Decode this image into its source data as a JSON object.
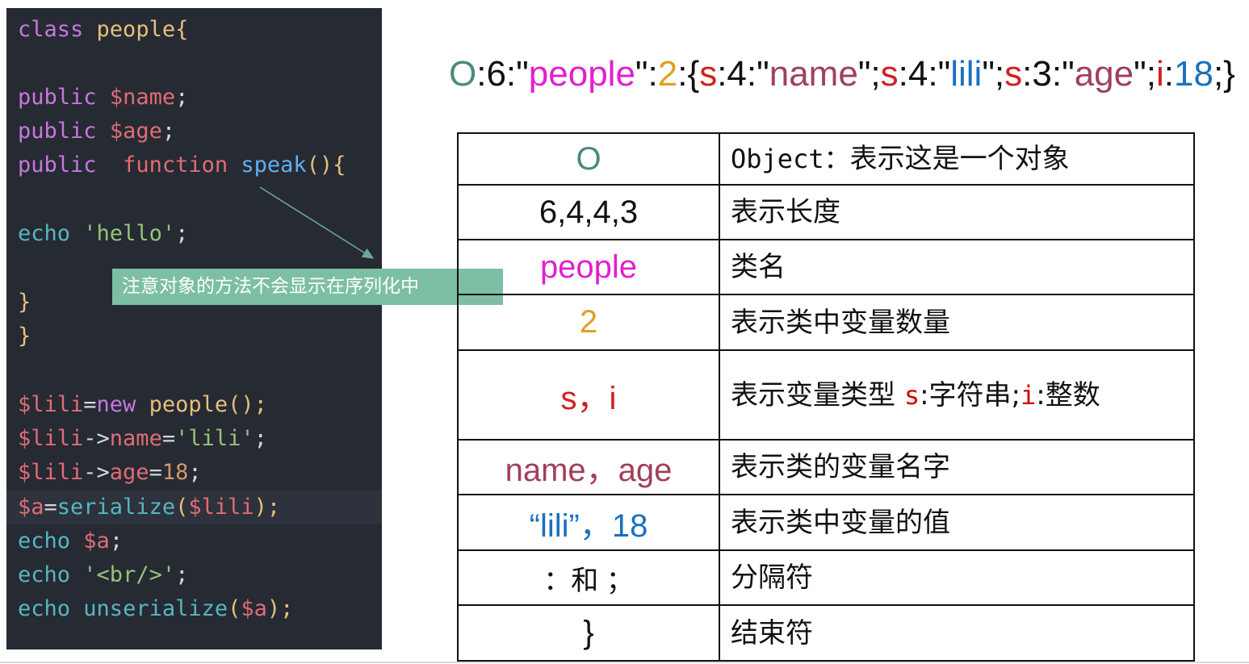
{
  "code": {
    "lines": {
      "l1": {
        "kw": "class",
        "name": "people",
        "brace": "{"
      },
      "l2": {
        "kw": "public",
        "var": "$name",
        "end": ";"
      },
      "l3": {
        "kw": "public",
        "var": "$age",
        "end": ";"
      },
      "l4": {
        "kw": "public",
        "kw2": "function",
        "fn": "speak",
        "end": "(){"
      },
      "l5": {
        "kw": "echo",
        "str": "'hello'",
        "end": ";"
      },
      "l6": {
        "brace": "}"
      },
      "l7": {
        "brace": "}"
      },
      "l8": {
        "var": "$lili",
        "op": "=",
        "kw": "new",
        "cls": "people",
        "end": "();"
      },
      "l9": {
        "var": "$lili",
        "op": "->",
        "prop": "name",
        "eq": "=",
        "str": "'lili'",
        "end": ";"
      },
      "l10": {
        "var": "$lili",
        "op": "->",
        "prop": "age",
        "eq": "=",
        "num": "18",
        "end": ";"
      },
      "l11": {
        "var": "$a",
        "eq": "=",
        "fn": "serialize",
        "open": "(",
        "arg": "$lili",
        "end": ");"
      },
      "l12": {
        "kw": "echo",
        "var": "$a",
        "end": ";"
      },
      "l13": {
        "kw": "echo",
        "str": "'<br/>'",
        "end": ";"
      },
      "l14": {
        "kw": "echo",
        "fn": "unserialize",
        "open": "(",
        "arg": "$a",
        "end": ");"
      }
    }
  },
  "annotation": {
    "text": "注意对象的方法不会显示在序列化中"
  },
  "serialized": {
    "parts": {
      "O": "O",
      "c1": ":6:",
      "q1": "\"",
      "people": "people",
      "q2": "\"",
      "c2": ":",
      "n2": "2",
      "c3": ":{",
      "s1": "s",
      "c4": ":4:\"",
      "name": "name",
      "c5": "\";",
      "s2": "s",
      "c6": ":4:\"",
      "lili": "lili",
      "c7": "\";",
      "s3": "s",
      "c8": ":3:\"",
      "age": "age",
      "c9": "\";",
      "i": "i",
      "c10": ":",
      "n18": "18",
      "end": ";}"
    }
  },
  "table": {
    "rows": {
      "r1": {
        "symbol": "O",
        "desc_prefix": "Object：",
        "desc": "表示这是一个对象"
      },
      "r2": {
        "symbol": "6,4,4,3",
        "desc": "表示长度"
      },
      "r3": {
        "symbol": "people",
        "desc": "类名"
      },
      "r4": {
        "symbol": "2",
        "desc": "表示类中变量数量"
      },
      "r5": {
        "symbol": "s，i",
        "desc": "表示变量类型",
        "s": "s",
        "s_desc": ":字符串;",
        "i": "i",
        "i_desc": ":整数"
      },
      "r6": {
        "symbol": "name，age",
        "desc": "表示类的变量名字"
      },
      "r7": {
        "symbol": "“lili”，18",
        "desc": "表示类中变量的值"
      },
      "r8": {
        "symbol": "：和 ；",
        "desc": "分隔符"
      },
      "r9": {
        "symbol": "}",
        "desc": "结束符"
      }
    }
  },
  "colors": {
    "O": "#4a8a7e",
    "people": "#e020d0",
    "count": "#e0a020",
    "type": "#d02020",
    "varname": "#a0405a",
    "value": "#1a70c0",
    "code_bg": "#262a33",
    "annotation_bg": "#7cbfa5"
  }
}
